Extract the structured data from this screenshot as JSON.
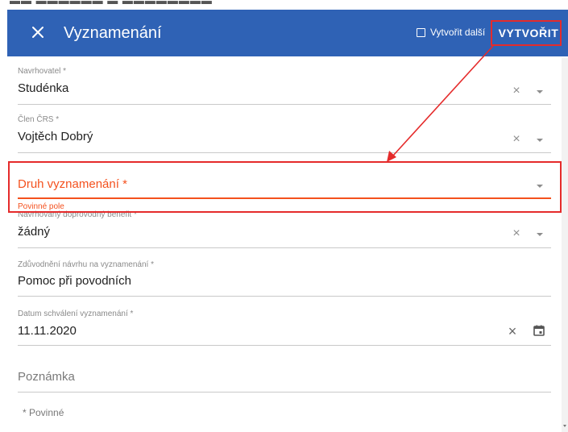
{
  "dialog": {
    "title": "Vyznamenání",
    "create_another_label": "Vytvořit další",
    "create_label": "VYTVOŘIT"
  },
  "fields": {
    "proposer": {
      "label": "Navrhovatel *",
      "value": "Studénka"
    },
    "member": {
      "label": "Člen ČRS *",
      "value": "Vojtěch Dobrý"
    },
    "award_type": {
      "label": "Druh vyznamenání *",
      "error": "Povinné pole"
    },
    "benefit": {
      "label": "Navrhovaný doprovodný benefit *",
      "value": "žádný"
    },
    "justification": {
      "label": "Zdůvodnění návrhu na vyznamenání *",
      "value": "Pomoc při povodních"
    },
    "approval_date": {
      "label": "Datum schválení vyznamenání *",
      "value": "11.11.2020"
    },
    "note": {
      "placeholder": "Poznámka"
    }
  },
  "footer": {
    "required_note": "* Povinné"
  },
  "colors": {
    "appbar": "#2f62b5",
    "error": "#f4511e",
    "highlight": "#e52b2b"
  },
  "icons": {
    "close": "close-icon",
    "clear": "clear-icon",
    "dropdown": "chevron-down-icon",
    "calendar": "calendar-icon",
    "checkbox": "checkbox-icon"
  }
}
